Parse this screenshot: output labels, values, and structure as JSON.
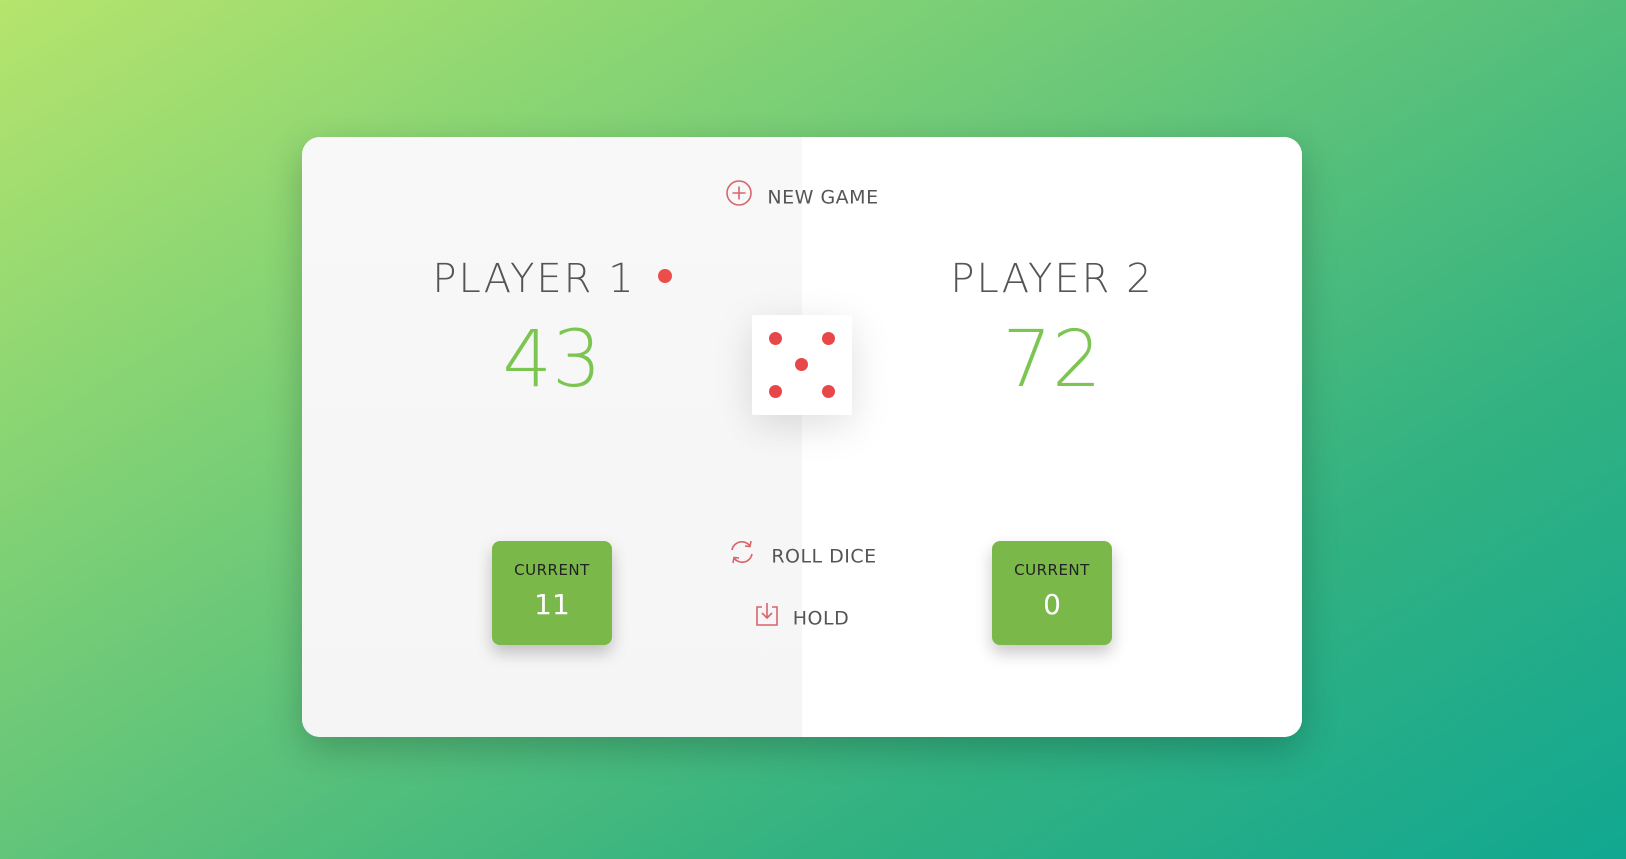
{
  "controls": {
    "new_game_label": "NEW GAME",
    "roll_dice_label": "ROLL DICE",
    "hold_label": "HOLD"
  },
  "players": [
    {
      "name": "PLAYER 1",
      "score": "43",
      "current_label": "CURRENT",
      "current_score": "11",
      "active": true
    },
    {
      "name": "PLAYER 2",
      "score": "72",
      "current_label": "CURRENT",
      "current_score": "0",
      "active": false
    }
  ],
  "dice": {
    "value": 5
  },
  "icons": {
    "new_game": "plus-circle-icon",
    "roll_dice": "refresh-icon",
    "hold": "download-icon",
    "active_player": "active-player-dot"
  },
  "colors": {
    "accent": "#eb4d4b",
    "score": "#7dc552",
    "current_box": "#7ab84a"
  }
}
